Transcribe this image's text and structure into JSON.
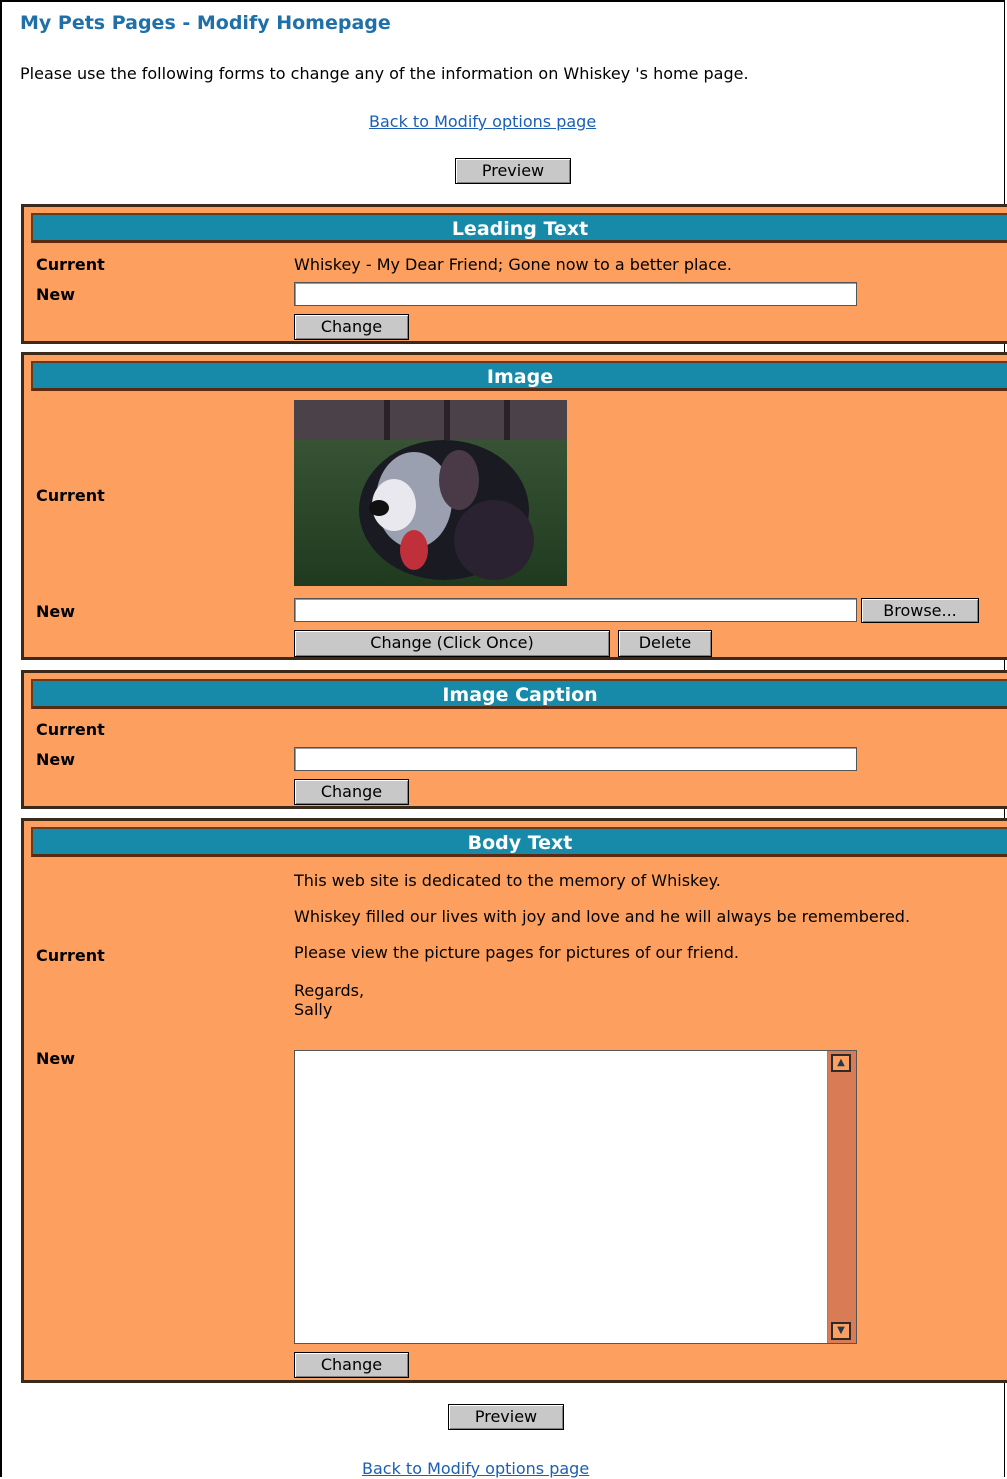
{
  "page": {
    "title": "My Pets Pages - Modify Homepage",
    "intro": "Please use the following forms to change any of the information on Whiskey 's home page.",
    "back_link": "Back to Modify options page",
    "preview_label": "Preview"
  },
  "leading_text": {
    "header": "Leading Text",
    "current_label": "Current",
    "new_label": "New",
    "current_value": "Whiskey - My Dear Friend; Gone now to a better place.",
    "new_value": "",
    "change_label": "Change"
  },
  "image": {
    "header": "Image",
    "current_label": "Current",
    "new_label": "New",
    "file_value": "",
    "browse_label": "Browse...",
    "change_label": "Change (Click Once)",
    "delete_label": "Delete"
  },
  "image_caption": {
    "header": "Image Caption",
    "current_label": "Current",
    "new_label": "New",
    "current_value": "",
    "new_value": "",
    "change_label": "Change"
  },
  "body_text": {
    "header": "Body Text",
    "current_label": "Current",
    "new_label": "New",
    "para1": "This web site is dedicated to the memory of Whiskey.",
    "para2": "Whiskey filled our lives with joy and love and he will always be remembered.",
    "para3": "Please view the picture pages for pictures of our friend.",
    "para4_line1": "Regards,",
    "para4_line2": "Sally",
    "new_value": "",
    "change_label": "Change"
  },
  "colors": {
    "panel_bg": "#fd9f5f",
    "header_bg": "#168aa8",
    "title_color": "#1f6fa8",
    "link_color": "#1a5fb4"
  },
  "icons": {
    "scroll_up": "scroll-up-arrow-icon",
    "scroll_down": "scroll-down-arrow-icon"
  }
}
